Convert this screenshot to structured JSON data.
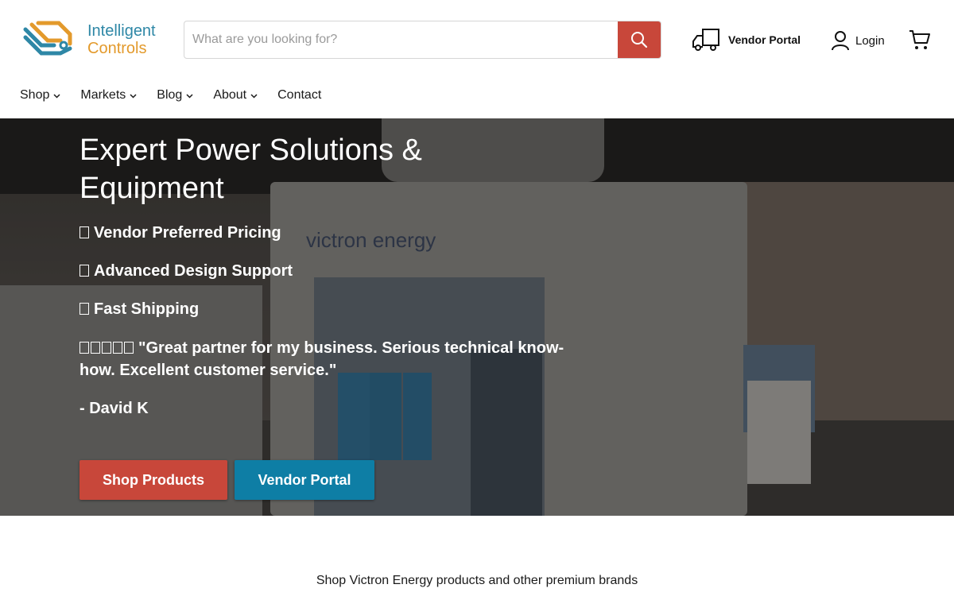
{
  "header": {
    "logo_line1": "Intelligent",
    "logo_line2": "Controls",
    "search_placeholder": "What are you looking for?",
    "vendor_portal": "Vendor Portal",
    "login": "Login"
  },
  "nav": {
    "items": [
      {
        "label": "Shop",
        "has_dropdown": true
      },
      {
        "label": "Markets",
        "has_dropdown": true
      },
      {
        "label": "Blog",
        "has_dropdown": true
      },
      {
        "label": "About",
        "has_dropdown": true
      },
      {
        "label": "Contact",
        "has_dropdown": false
      }
    ]
  },
  "hero": {
    "title": "Expert Power Solutions & Equipment",
    "features": [
      "Vendor Preferred Pricing",
      "Advanced Design Support",
      "Fast Shipping"
    ],
    "testimonial": "\"Great partner for my business. Serious technical know-how. Excellent customer service.\"",
    "author": "- David K",
    "background_text": "victron energy",
    "buttons": {
      "shop": "Shop Products",
      "vendor": "Vendor Portal"
    }
  },
  "brands_line": "Shop Victron Energy products and other premium brands",
  "colors": {
    "accent_red": "#c8473a",
    "accent_blue": "#0e7ea5",
    "logo_blue": "#2e87a6",
    "logo_orange": "#e39a2c"
  },
  "icons": {
    "search": "search-icon",
    "truck": "truck-icon",
    "user": "user-icon",
    "cart": "cart-icon"
  }
}
